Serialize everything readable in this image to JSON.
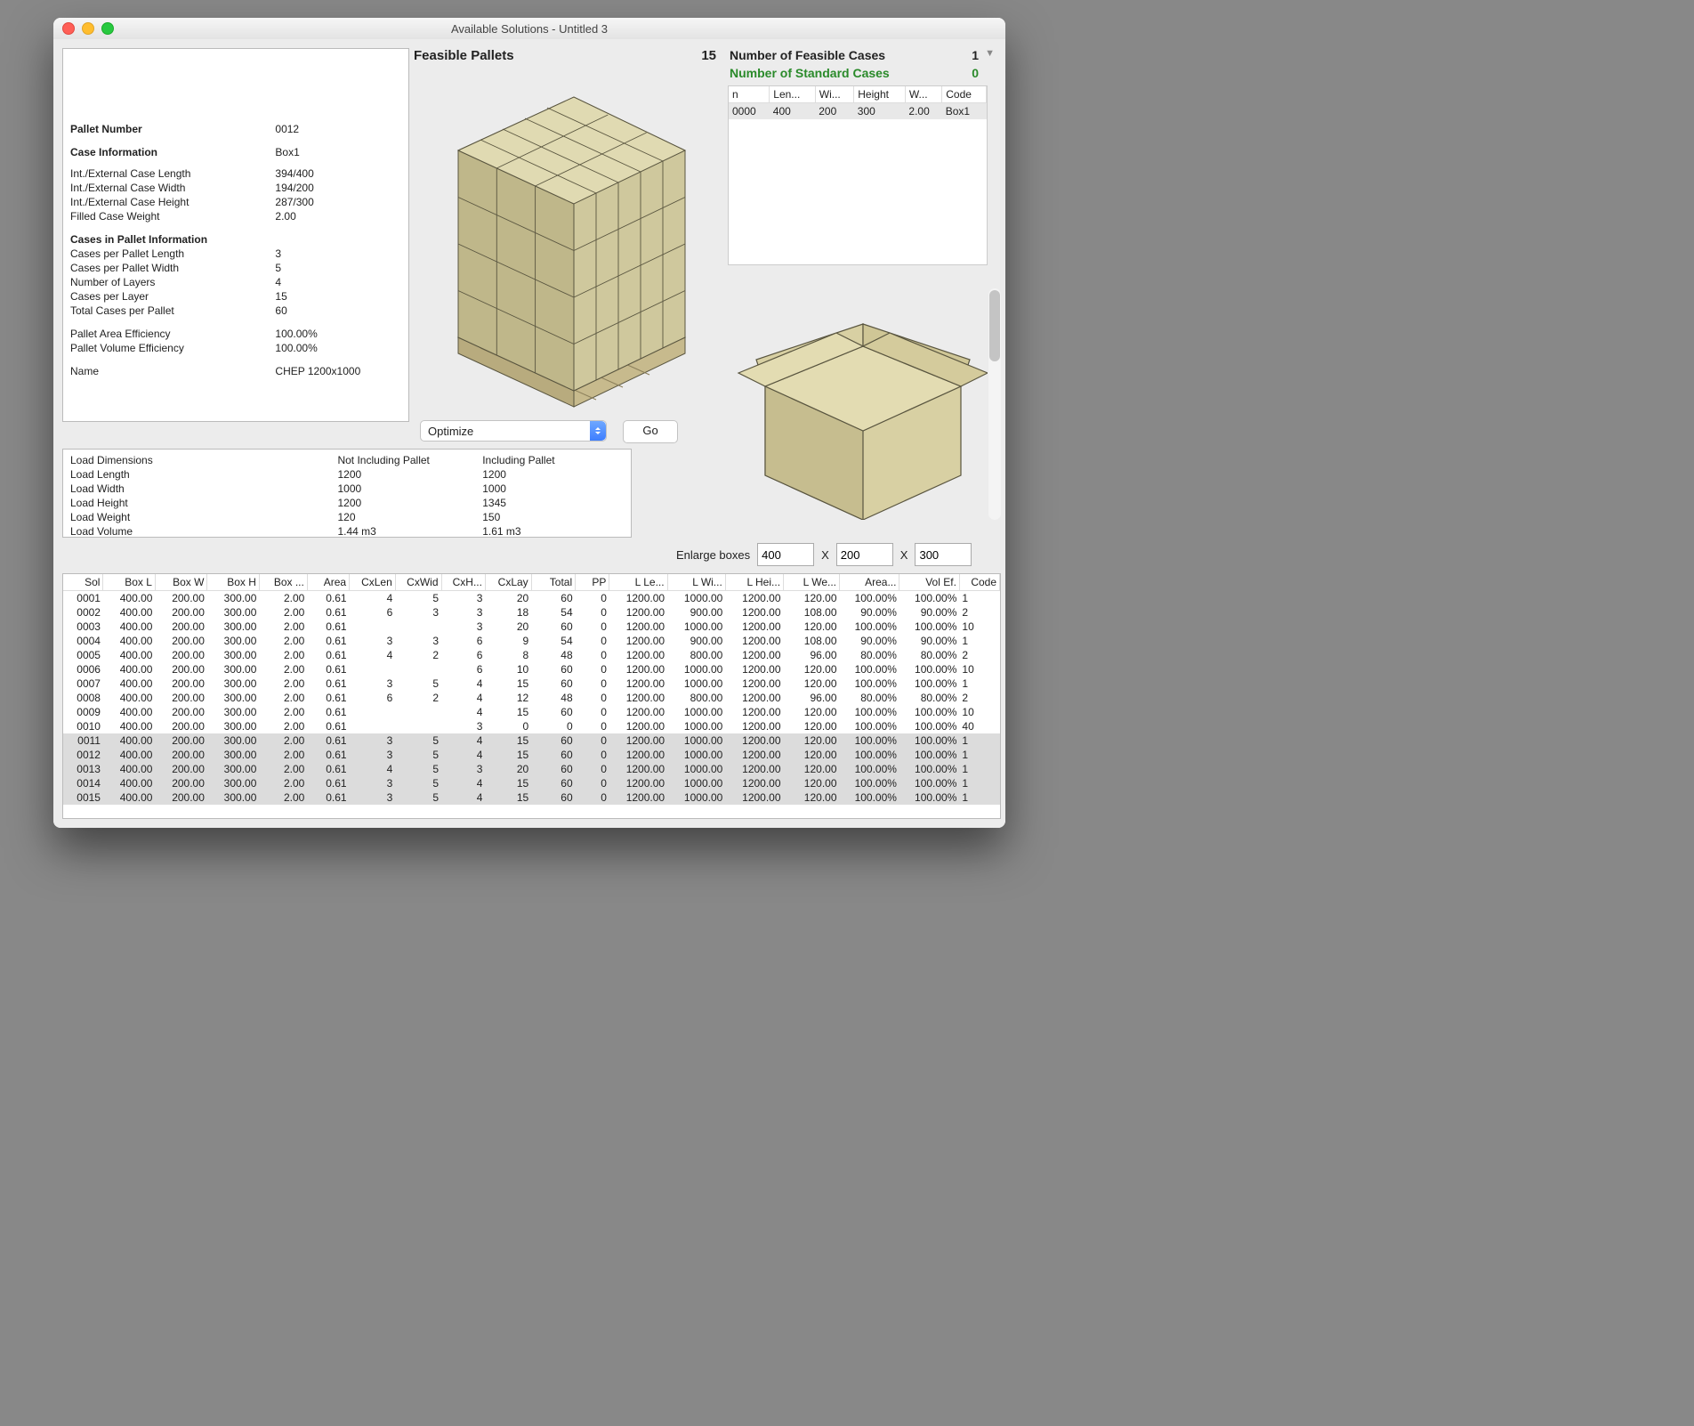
{
  "window_title": "Available Solutions - Untitled 3",
  "info": {
    "pallet_number_lbl": "Pallet Number",
    "pallet_number": "0012",
    "case_info_lbl": "Case Information",
    "case_info": "Box1",
    "ie_len_lbl": "Int./External Case Length",
    "ie_len": "394/400",
    "ie_wid_lbl": "Int./External Case Width",
    "ie_wid": "194/200",
    "ie_hei_lbl": "Int./External Case Height",
    "ie_hei": "287/300",
    "fcw_lbl": "Filled Case Weight",
    "fcw": "2.00",
    "cpi_lbl": "Cases in Pallet Information",
    "cpl_lbl": "Cases per Pallet Length",
    "cpl": "3",
    "cpw_lbl": "Cases per Pallet Width",
    "cpw": "5",
    "nl_lbl": "Number of Layers",
    "nl": "4",
    "cplay_lbl": "Cases per Layer",
    "cplay": "15",
    "tcp_lbl": "Total Cases per Pallet",
    "tcp": "60",
    "pae_lbl": "Pallet Area Efficiency",
    "pae": "100.00%",
    "pve_lbl": "Pallet Volume Efficiency",
    "pve": "100.00%",
    "name_lbl": "Name",
    "name": "CHEP 1200x1000"
  },
  "feasible": {
    "lbl": "Feasible Pallets",
    "count": "15"
  },
  "cases": {
    "feasible_lbl": "Number of Feasible Cases",
    "feasible": "1",
    "std_lbl": "Number of Standard Cases",
    "std": "0",
    "headers": [
      "n",
      "Len...",
      "Wi...",
      "Height",
      "W...",
      "Code"
    ],
    "row": {
      "n": "0000",
      "len": "400",
      "wid": "200",
      "hei": "300",
      "w": "2.00",
      "code": "Box1"
    }
  },
  "dd": {
    "value": "Optimize",
    "go": "Go"
  },
  "load": {
    "dim_lbl": "Load Dimensions",
    "not_lbl": "Not Including Pallet",
    "inc_lbl": "Including Pallet",
    "len_lbl": "Load Length",
    "len_n": "1200",
    "len_i": "1200",
    "wid_lbl": "Load Width",
    "wid_n": "1000",
    "wid_i": "1000",
    "hei_lbl": "Load Height",
    "hei_n": "1200",
    "hei_i": "1345",
    "wgt_lbl": "Load Weight",
    "wgt_n": "120",
    "wgt_i": "150",
    "vol_lbl": "Load Volume",
    "vol_n": "1.44 m3",
    "vol_i": "1.61 m3"
  },
  "enlarge": {
    "lbl": "Enlarge boxes",
    "x": "X",
    "a": "400",
    "b": "200",
    "c": "300"
  },
  "grid": {
    "headers": [
      "Sol",
      "Box L",
      "Box W",
      "Box H",
      "Box ...",
      "Area",
      "CxLen",
      "CxWid",
      "CxH...",
      "CxLay",
      "Total",
      "PP",
      "L Le...",
      "L Wi...",
      "L Hei...",
      "L We...",
      "Area...",
      "Vol Ef.",
      "Code"
    ],
    "rows": [
      [
        "0001",
        "400.00",
        "200.00",
        "300.00",
        "2.00",
        "0.61",
        "4",
        "5",
        "3",
        "20",
        "60",
        "0",
        "1200.00",
        "1000.00",
        "1200.00",
        "120.00",
        "100.00%",
        "100.00%",
        "1"
      ],
      [
        "0002",
        "400.00",
        "200.00",
        "300.00",
        "2.00",
        "0.61",
        "6",
        "3",
        "3",
        "18",
        "54",
        "0",
        "1200.00",
        "900.00",
        "1200.00",
        "108.00",
        "90.00%",
        "90.00%",
        "2"
      ],
      [
        "0003",
        "400.00",
        "200.00",
        "300.00",
        "2.00",
        "0.61",
        "",
        "",
        "3",
        "20",
        "60",
        "0",
        "1200.00",
        "1000.00",
        "1200.00",
        "120.00",
        "100.00%",
        "100.00%",
        "10"
      ],
      [
        "0004",
        "400.00",
        "200.00",
        "300.00",
        "2.00",
        "0.61",
        "3",
        "3",
        "6",
        "9",
        "54",
        "0",
        "1200.00",
        "900.00",
        "1200.00",
        "108.00",
        "90.00%",
        "90.00%",
        "1"
      ],
      [
        "0005",
        "400.00",
        "200.00",
        "300.00",
        "2.00",
        "0.61",
        "4",
        "2",
        "6",
        "8",
        "48",
        "0",
        "1200.00",
        "800.00",
        "1200.00",
        "96.00",
        "80.00%",
        "80.00%",
        "2"
      ],
      [
        "0006",
        "400.00",
        "200.00",
        "300.00",
        "2.00",
        "0.61",
        "",
        "",
        "6",
        "10",
        "60",
        "0",
        "1200.00",
        "1000.00",
        "1200.00",
        "120.00",
        "100.00%",
        "100.00%",
        "10"
      ],
      [
        "0007",
        "400.00",
        "200.00",
        "300.00",
        "2.00",
        "0.61",
        "3",
        "5",
        "4",
        "15",
        "60",
        "0",
        "1200.00",
        "1000.00",
        "1200.00",
        "120.00",
        "100.00%",
        "100.00%",
        "1"
      ],
      [
        "0008",
        "400.00",
        "200.00",
        "300.00",
        "2.00",
        "0.61",
        "6",
        "2",
        "4",
        "12",
        "48",
        "0",
        "1200.00",
        "800.00",
        "1200.00",
        "96.00",
        "80.00%",
        "80.00%",
        "2"
      ],
      [
        "0009",
        "400.00",
        "200.00",
        "300.00",
        "2.00",
        "0.61",
        "",
        "",
        "4",
        "15",
        "60",
        "0",
        "1200.00",
        "1000.00",
        "1200.00",
        "120.00",
        "100.00%",
        "100.00%",
        "10"
      ],
      [
        "0010",
        "400.00",
        "200.00",
        "300.00",
        "2.00",
        "0.61",
        "",
        "",
        "3",
        "0",
        "0",
        "0",
        "1200.00",
        "1000.00",
        "1200.00",
        "120.00",
        "100.00%",
        "100.00%",
        "40"
      ],
      [
        "0011",
        "400.00",
        "200.00",
        "300.00",
        "2.00",
        "0.61",
        "3",
        "5",
        "4",
        "15",
        "60",
        "0",
        "1200.00",
        "1000.00",
        "1200.00",
        "120.00",
        "100.00%",
        "100.00%",
        "1"
      ],
      [
        "0012",
        "400.00",
        "200.00",
        "300.00",
        "2.00",
        "0.61",
        "3",
        "5",
        "4",
        "15",
        "60",
        "0",
        "1200.00",
        "1000.00",
        "1200.00",
        "120.00",
        "100.00%",
        "100.00%",
        "1"
      ],
      [
        "0013",
        "400.00",
        "200.00",
        "300.00",
        "2.00",
        "0.61",
        "4",
        "5",
        "3",
        "20",
        "60",
        "0",
        "1200.00",
        "1000.00",
        "1200.00",
        "120.00",
        "100.00%",
        "100.00%",
        "1"
      ],
      [
        "0014",
        "400.00",
        "200.00",
        "300.00",
        "2.00",
        "0.61",
        "3",
        "5",
        "4",
        "15",
        "60",
        "0",
        "1200.00",
        "1000.00",
        "1200.00",
        "120.00",
        "100.00%",
        "100.00%",
        "1"
      ],
      [
        "0015",
        "400.00",
        "200.00",
        "300.00",
        "2.00",
        "0.61",
        "3",
        "5",
        "4",
        "15",
        "60",
        "0",
        "1200.00",
        "1000.00",
        "1200.00",
        "120.00",
        "100.00%",
        "100.00%",
        "1"
      ]
    ],
    "hl_start": 10
  }
}
